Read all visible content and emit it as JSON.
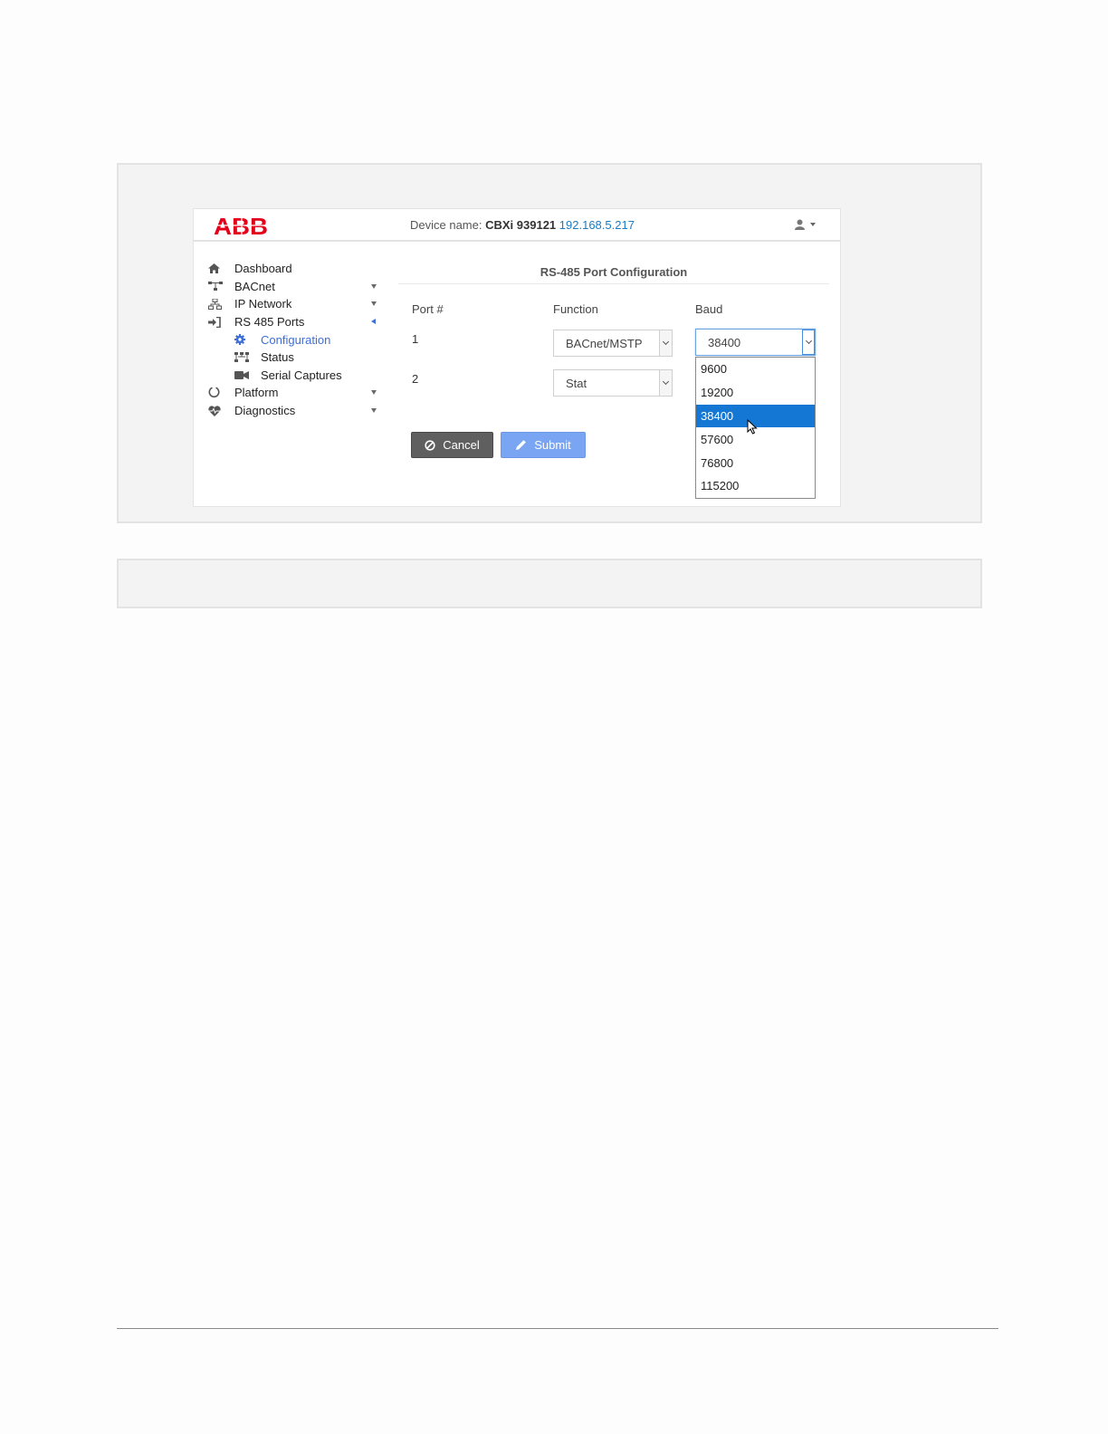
{
  "app": {
    "logo_text": "ABB",
    "device_label": "Device name:",
    "device_name": "CBXi 939121",
    "device_ip": "192.168.5.217"
  },
  "sidebar": {
    "items": [
      {
        "label": "Dashboard",
        "icon": "home-icon",
        "expandable": false
      },
      {
        "label": "BACnet",
        "icon": "network-tree-icon",
        "expandable": true
      },
      {
        "label": "IP Network",
        "icon": "sitemap-icon",
        "expandable": true
      },
      {
        "label": "RS 485 Ports",
        "icon": "sign-in-icon",
        "expandable": true,
        "expanded": true
      },
      {
        "label": "Configuration",
        "icon": "gear-icon",
        "sub": true,
        "active": true
      },
      {
        "label": "Status",
        "icon": "status-nodes-icon",
        "sub": true
      },
      {
        "label": "Serial Captures",
        "icon": "video-camera-icon",
        "sub": true
      },
      {
        "label": "Platform",
        "icon": "circle-notch-icon",
        "expandable": true
      },
      {
        "label": "Diagnostics",
        "icon": "heartbeat-icon",
        "expandable": true
      }
    ]
  },
  "main": {
    "title": "RS-485 Port Configuration",
    "columns": {
      "port": "Port #",
      "function": "Function",
      "baud": "Baud"
    },
    "rows": [
      {
        "port": "1",
        "function": "BACnet/MSTP",
        "baud": "38400"
      },
      {
        "port": "2",
        "function": "Stat"
      }
    ],
    "baud_options": [
      "9600",
      "19200",
      "38400",
      "57600",
      "76800",
      "115200"
    ],
    "baud_selected_index": 2,
    "cancel_label": "Cancel",
    "submit_label": "Submit"
  },
  "colors": {
    "brand_red": "#e2001a",
    "link_blue": "#1a7bbf",
    "active_nav": "#3d6fd6",
    "selected_option": "#1477d4",
    "submit_button": "#7aa5f2",
    "cancel_button": "#5f5f5f"
  }
}
